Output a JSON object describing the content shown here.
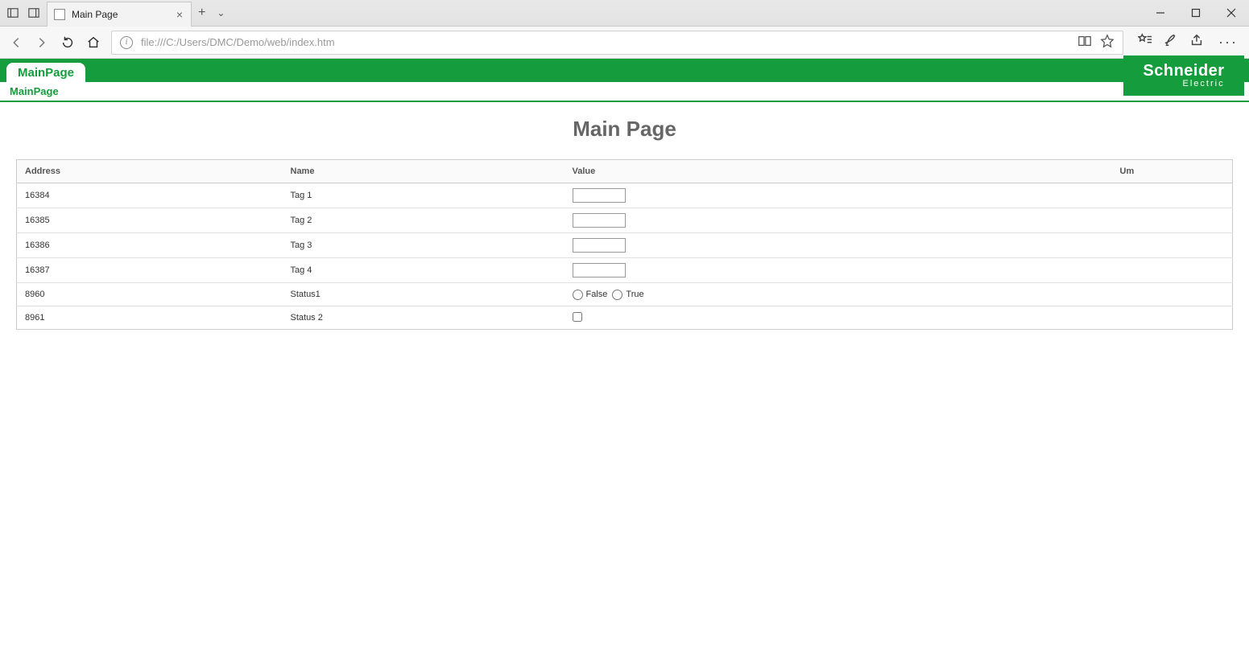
{
  "browser": {
    "tab_title": "Main Page",
    "url": "file:///C:/Users/DMC/Demo/web/index.htm"
  },
  "header": {
    "tab_label": "MainPage",
    "breadcrumb": "MainPage",
    "brand_top": "Schneider",
    "brand_bot": "Electric"
  },
  "page": {
    "title": "Main Page"
  },
  "table": {
    "columns": {
      "address": "Address",
      "name": "Name",
      "value": "Value",
      "um": "Um"
    },
    "rows": [
      {
        "address": "16384",
        "name": "Tag 1",
        "type": "text",
        "value": "",
        "um": ""
      },
      {
        "address": "16385",
        "name": "Tag 2",
        "type": "text",
        "value": "",
        "um": ""
      },
      {
        "address": "16386",
        "name": "Tag 3",
        "type": "text",
        "value": "",
        "um": ""
      },
      {
        "address": "16387",
        "name": "Tag 4",
        "type": "text",
        "value": "",
        "um": ""
      },
      {
        "address": "8960",
        "name": "Status1",
        "type": "radio",
        "false_label": "False",
        "true_label": "True",
        "um": ""
      },
      {
        "address": "8961",
        "name": "Status 2",
        "type": "check",
        "checked": false,
        "um": ""
      }
    ]
  }
}
